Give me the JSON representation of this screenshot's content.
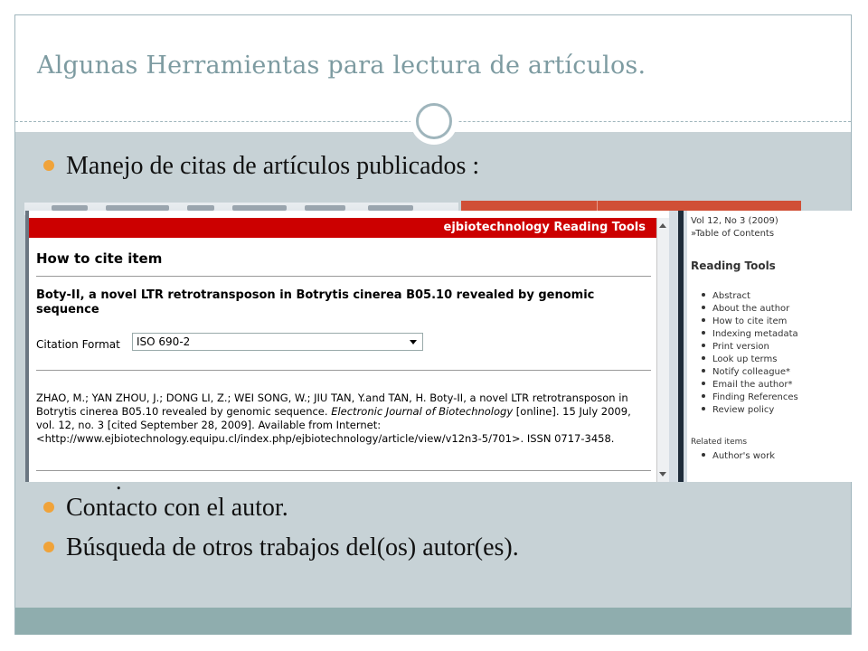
{
  "slide": {
    "title": "Algunas Herramientas para lectura de artículos.",
    "bullets": [
      "Manejo de citas de artículos publicados :",
      "Contacto con el autor.",
      "Búsqueda de otros trabajos del(os)  autor(es)."
    ]
  },
  "colors": {
    "title": "#7d9ba1",
    "content_bg": "#c7d2d6",
    "bottom_band": "#8fadae",
    "bullet": "#f0a33a",
    "header_red": "#cc0000"
  },
  "popup": {
    "header": "ejbiotechnology Reading Tools",
    "heading": "How to cite item",
    "article_title": "Boty-II, a novel LTR retrotransposon in Botrytis cinerea B05.10 revealed by genomic sequence",
    "format_label": "Citation Format",
    "format_value": "ISO 690-2",
    "citation_part1": "ZHAO, M.; YAN ZHOU, J.; DONG LI, Z.; WEI SONG, W.; JIU TAN, Y.and TAN, H. Boty-II, a novel LTR retrotransposon in Botrytis cinerea B05.10 revealed by genomic sequence. ",
    "citation_journal": "Electronic Journal of Biotechnology",
    "citation_part2": " [online]. 15 July 2009, vol. 12, no. 3 [cited September 28, 2009]. Available from Internet: <http://www.ejbiotechnology.equipu.cl/index.php/ejbiotechnology/article/view/v12n3-5/701>. ISSN 0717-3458."
  },
  "sidebar": {
    "issue": "Vol 12, No 3 (2009)",
    "toc": "»Table of Contents",
    "heading": "Reading Tools",
    "tools": [
      "Abstract",
      "About the author",
      "How to cite item",
      "Indexing metadata",
      "Print version",
      "Look up terms",
      "Notify colleague*",
      "Email the author*",
      "Finding References",
      "Review policy"
    ],
    "related_heading": "Related items",
    "related": [
      "Author's work"
    ]
  }
}
